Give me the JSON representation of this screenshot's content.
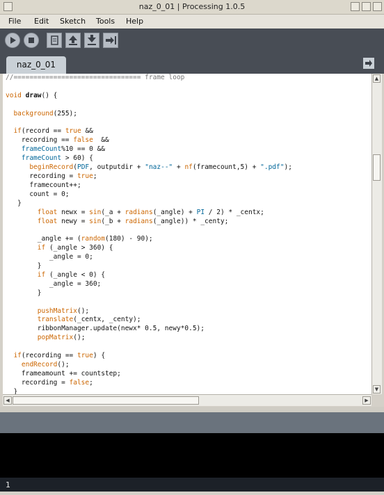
{
  "window": {
    "title": "naz_0_01 | Processing 1.0.5"
  },
  "menu": [
    "File",
    "Edit",
    "Sketch",
    "Tools",
    "Help"
  ],
  "toolbar": {
    "icons": [
      "run-icon",
      "stop-icon",
      "new-icon",
      "open-icon",
      "save-icon",
      "export-icon"
    ]
  },
  "tabs": [
    {
      "label": "naz_0_01",
      "active": true
    }
  ],
  "editor": {
    "lines": [
      "//================================ frame loop",
      "",
      "void draw() {",
      "",
      "  background(255);",
      "",
      "  if(record == true &&",
      "    recording == false  &&",
      "    frameCount%10 == 0 &&",
      "    frameCount > 60) {",
      "      beginRecord(PDF, outputdir + \"naz--\" + nf(framecount,5) + \".pdf\");",
      "      recording = true;",
      "      framecount++;",
      "      count = 0;",
      "   }",
      "        float newx = sin(_a + radians(_angle) + PI / 2) * _centx;",
      "        float newy = sin(_b + radians(_angle)) * _centy;",
      "",
      "        _angle += (random(180) - 90);",
      "        if (_angle > 360) {",
      "           _angle = 0;",
      "        }",
      "        if (_angle < 0) {",
      "           _angle = 360;",
      "        }",
      "",
      "        pushMatrix();",
      "        translate(_centx, _centy);",
      "        ribbonManager.update(newx* 0.5, newy*0.5);",
      "        popMatrix();",
      "",
      "  if(recording == true) {",
      "    endRecord();",
      "    frameamount += countstep;",
      "    recording = false;",
      "  }"
    ]
  },
  "status": {
    "line_number": "1"
  },
  "colors": {
    "toolbar_bg": "#484d55",
    "tab_bg": "#c9d0d6",
    "keyword": "#cc6600",
    "keyword_alt": "#006699",
    "comment": "#777777",
    "console_bg": "#000000"
  }
}
